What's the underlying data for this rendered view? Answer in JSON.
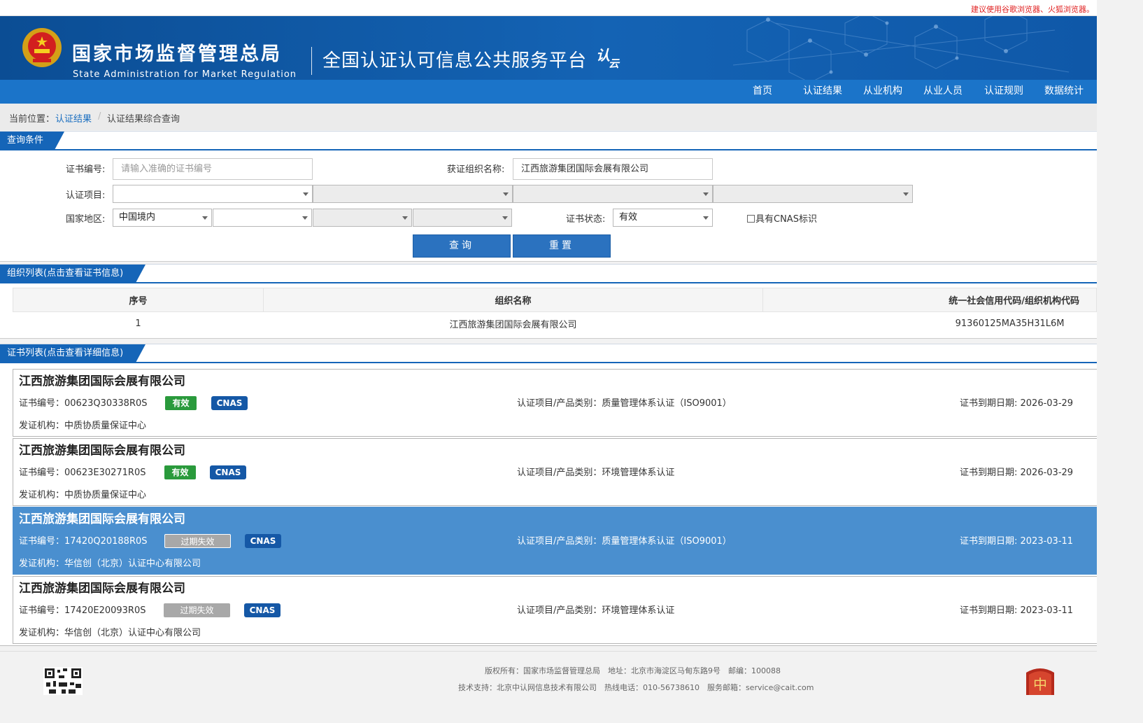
{
  "top_tip": "建议使用谷歌浏览器、火狐浏览器。",
  "header": {
    "org_cn": "国家市场监督管理总局",
    "org_en": "State Administration for Market Regulation",
    "platform": "全国认证认可信息公共服务平台",
    "cloud_logo": "认",
    "cloud_logo_sub": "云"
  },
  "nav": [
    "首页",
    "认证结果",
    "从业机构",
    "从业人员",
    "认证规则",
    "数据统计"
  ],
  "breadcrumb": {
    "label": "当前位置：",
    "link": "认证结果",
    "separator": "/",
    "current": "认证结果综合查询"
  },
  "query": {
    "title": "查询条件",
    "cert_no_label": "证书编号:",
    "cert_no_placeholder": "请输入准确的证书编号",
    "org_name_label": "获证组织名称:",
    "org_name_value": "江西旅游集团国际会展有限公司",
    "project_label": "认证项目:",
    "region_label": "国家地区:",
    "region_value": "中国境内",
    "status_label": "证书状态:",
    "status_value": "有效",
    "cnas_label": "具有CNAS标识",
    "query_button": "查询",
    "reset_button": "重置"
  },
  "org_list": {
    "title": "组织列表(点击查看证书信息)",
    "headers": [
      "序号",
      "组织名称",
      "统一社会信用代码/组织机构代码"
    ],
    "rows": [
      [
        "1",
        "江西旅游集团国际会展有限公司",
        "91360125MA35H31L6M"
      ]
    ]
  },
  "cert_list": {
    "title": "证书列表(点击查看详细信息)",
    "items": [
      {
        "org": "江西旅游集团国际会展有限公司",
        "cert_no": "证书编号：00623Q30338R0S",
        "status": "有效",
        "cnas": "CNAS",
        "project": "认证项目/产品类别：质量管理体系认证（ISO9001）",
        "expiry": "证书到期日期: 2026-03-29",
        "issuer": "发证机构：中质协质量保证中心"
      },
      {
        "org": "江西旅游集团国际会展有限公司",
        "cert_no": "证书编号：00623E30271R0S",
        "status": "有效",
        "cnas": "CNAS",
        "project": "认证项目/产品类别：环境管理体系认证",
        "expiry": "证书到期日期: 2026-03-29",
        "issuer": "发证机构：中质协质量保证中心"
      },
      {
        "org": "江西旅游集团国际会展有限公司",
        "cert_no": "证书编号：17420Q20188R0S",
        "status": "过期失效",
        "cnas": "CNAS",
        "project": "认证项目/产品类别：质量管理体系认证（ISO9001）",
        "expiry": "证书到期日期: 2023-03-11",
        "issuer": "发证机构：华信创（北京）认证中心有限公司"
      },
      {
        "org": "江西旅游集团国际会展有限公司",
        "cert_no": "证书编号：17420E20093R0S",
        "status": "过期失效",
        "cnas": "CNAS",
        "project": "认证项目/产品类别：环境管理体系认证",
        "expiry": "证书到期日期: 2023-03-11",
        "issuer": "发证机构：华信创（北京）认证中心有限公司"
      }
    ]
  },
  "footer": {
    "line1": "版权所有：国家市场监督管理总局　地址：北京市海淀区马甸东路9号　邮编：100088",
    "line2": "技术支持：北京中认网信息技术有限公司　热线电话：010-56738610　服务邮箱：service@cait.com"
  },
  "colors": {
    "header_blue": "#1463b4",
    "nav_blue": "#1b74c9",
    "panel_title": "#1565b8",
    "valid_green": "#2a9a3c",
    "cnas_blue": "#1558a6",
    "highlight_row": "#4a8fcf",
    "tip_red": "#e02020"
  }
}
